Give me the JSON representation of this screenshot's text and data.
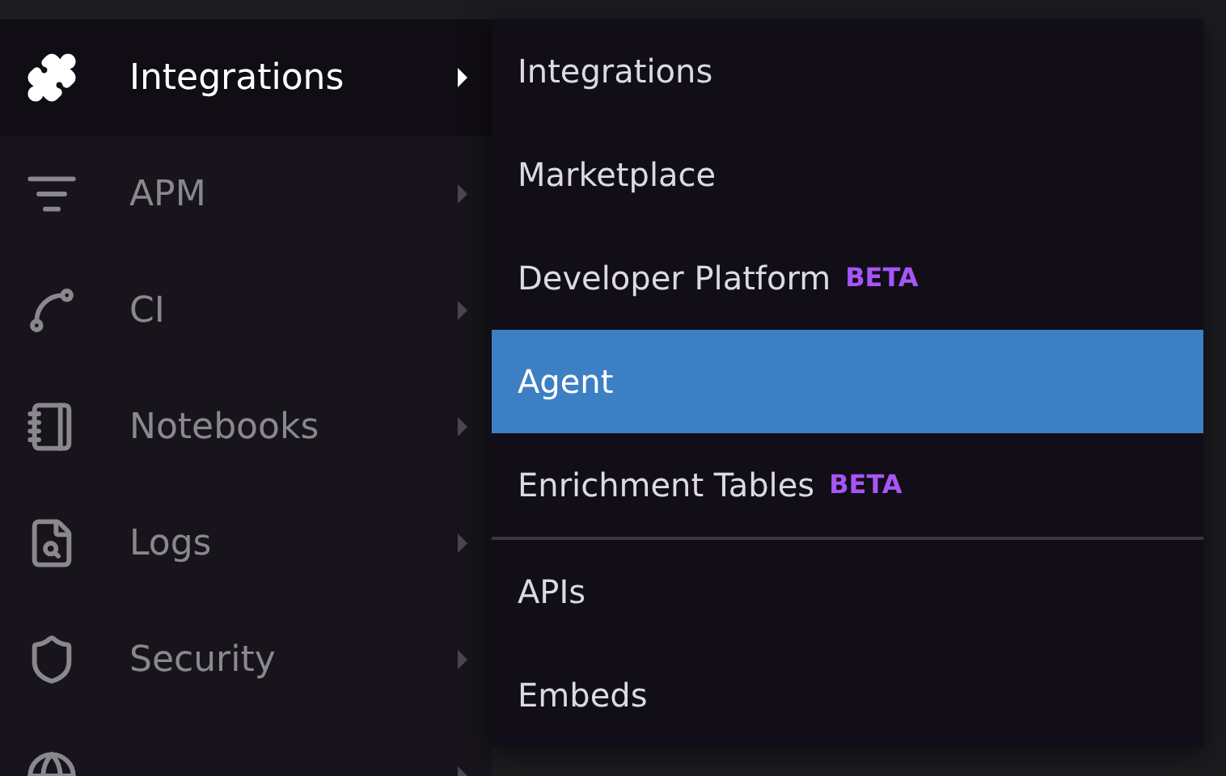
{
  "sidebar": {
    "items": [
      {
        "label": "Integrations",
        "selected": true
      },
      {
        "label": "APM",
        "selected": false
      },
      {
        "label": "CI",
        "selected": false
      },
      {
        "label": "Notebooks",
        "selected": false
      },
      {
        "label": "Logs",
        "selected": false
      },
      {
        "label": "Security",
        "selected": false
      },
      {
        "selected": false
      }
    ]
  },
  "submenu": {
    "items": [
      {
        "label": "Integrations",
        "selected": false
      },
      {
        "label": "Marketplace",
        "selected": false
      },
      {
        "label": "Developer Platform",
        "badge": "BETA",
        "selected": false
      },
      {
        "label": "Agent",
        "selected": true
      },
      {
        "label": "Enrichment Tables",
        "badge": "BETA",
        "selected": false
      },
      {
        "kind": "divider"
      },
      {
        "label": "APIs",
        "selected": false
      },
      {
        "label": "Embeds",
        "selected": false
      }
    ]
  }
}
